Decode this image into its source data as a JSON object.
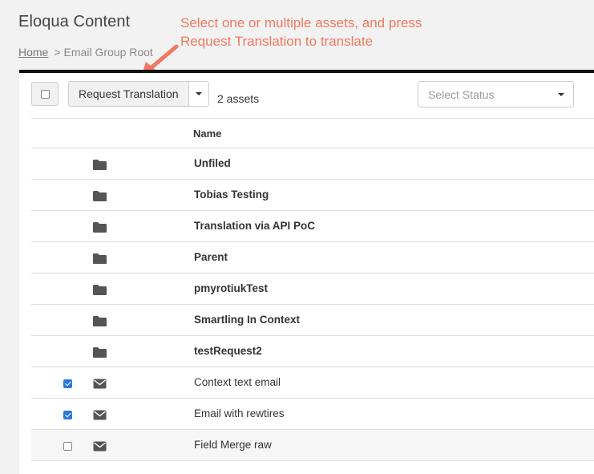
{
  "app_title": "Eloqua Content",
  "annotation": {
    "line1": "Select one or multiple assets, and press",
    "line2": "Request Translation to translate",
    "color": "#f07860"
  },
  "breadcrumb": {
    "home": "Home",
    "separator": ">",
    "current": "Email Group Root"
  },
  "toolbar": {
    "request_translation_label": "Request Translation",
    "asset_count": "2 assets",
    "status_placeholder": "Select Status"
  },
  "table": {
    "name_header": "Name",
    "rows": [
      {
        "type": "folder",
        "icon": "folder-icon",
        "name": "Unfiled"
      },
      {
        "type": "folder",
        "icon": "folder-icon",
        "name": "Tobias Testing"
      },
      {
        "type": "folder",
        "icon": "folder-icon",
        "name": "Translation via API PoC"
      },
      {
        "type": "folder",
        "icon": "folder-icon",
        "name": "Parent"
      },
      {
        "type": "folder",
        "icon": "folder-icon",
        "name": "pmyrotiukTest"
      },
      {
        "type": "folder",
        "icon": "folder-icon",
        "name": "Smartling In Context"
      },
      {
        "type": "folder",
        "icon": "folder-icon",
        "name": "testRequest2"
      },
      {
        "type": "email",
        "icon": "envelope-icon",
        "name": "Context text email",
        "checked": true
      },
      {
        "type": "email",
        "icon": "envelope-icon",
        "name": "Email with rewtires",
        "checked": true
      },
      {
        "type": "email",
        "icon": "envelope-icon",
        "name": "Field Merge raw",
        "checked": false
      }
    ]
  },
  "colors": {
    "accent": "#2a7bd8",
    "panel_border": "#111111",
    "background": "#f2f2f2"
  }
}
